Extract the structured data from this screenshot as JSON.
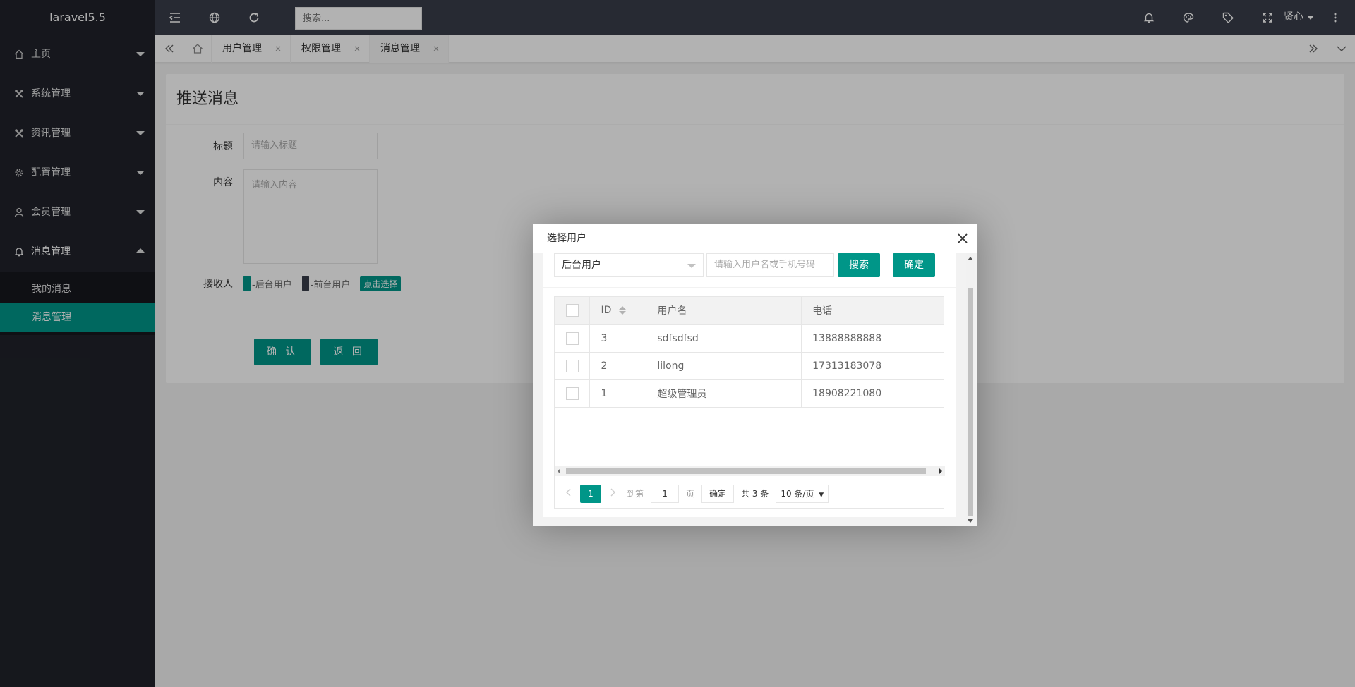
{
  "app": {
    "logo": "laravel5.5"
  },
  "sidebar": {
    "items": [
      {
        "label": "主页",
        "icon": "home-icon",
        "expanded": false
      },
      {
        "label": "系统管理",
        "icon": "tools-icon",
        "expanded": false
      },
      {
        "label": "资讯管理",
        "icon": "tools-icon",
        "expanded": false
      },
      {
        "label": "配置管理",
        "icon": "gear-icon",
        "expanded": false
      },
      {
        "label": "会员管理",
        "icon": "user-icon",
        "expanded": false
      },
      {
        "label": "消息管理",
        "icon": "bell-icon",
        "expanded": true
      }
    ],
    "subitems": [
      {
        "label": "我的消息",
        "active": false
      },
      {
        "label": "消息管理",
        "active": true
      }
    ]
  },
  "header": {
    "search_placeholder": "搜索...",
    "username": "贤心"
  },
  "tabs": {
    "items": [
      {
        "label": "用户管理",
        "active": false
      },
      {
        "label": "权限管理",
        "active": false
      },
      {
        "label": "消息管理",
        "active": true
      }
    ],
    "close_glyph": "×"
  },
  "form": {
    "title": "推送消息",
    "title_label": "标题",
    "title_placeholder": "请输入标题",
    "content_label": "内容",
    "content_placeholder": "请输入内容",
    "receiver_label": "接收人",
    "backend_users": "-后台用户",
    "frontend_users": "-前台用户",
    "choose_button": "点击选择",
    "confirm_button": "确 认",
    "back_button": "返 回"
  },
  "modal": {
    "title": "选择用户",
    "select_value": "后台用户",
    "keyword_placeholder": "请输入用户名或手机号码",
    "search_button": "搜索",
    "confirm_button": "确定",
    "table": {
      "headers": [
        "ID",
        "用户名",
        "电话"
      ],
      "rows": [
        {
          "id": "3",
          "username": "sdfsdfsd",
          "phone": "13888888888"
        },
        {
          "id": "2",
          "username": "lilong",
          "phone": "17313183078"
        },
        {
          "id": "1",
          "username": "超级管理员",
          "phone": "18908221080"
        }
      ]
    },
    "pager": {
      "current": "1",
      "goto_label": "到第",
      "goto_value": "1",
      "page_unit": "页",
      "goto_button": "确定",
      "total": "共 3 条",
      "limit": "10 条/页"
    }
  },
  "colors": {
    "primary": "#009688",
    "sidebar": "#20222a",
    "header": "#393d49"
  }
}
